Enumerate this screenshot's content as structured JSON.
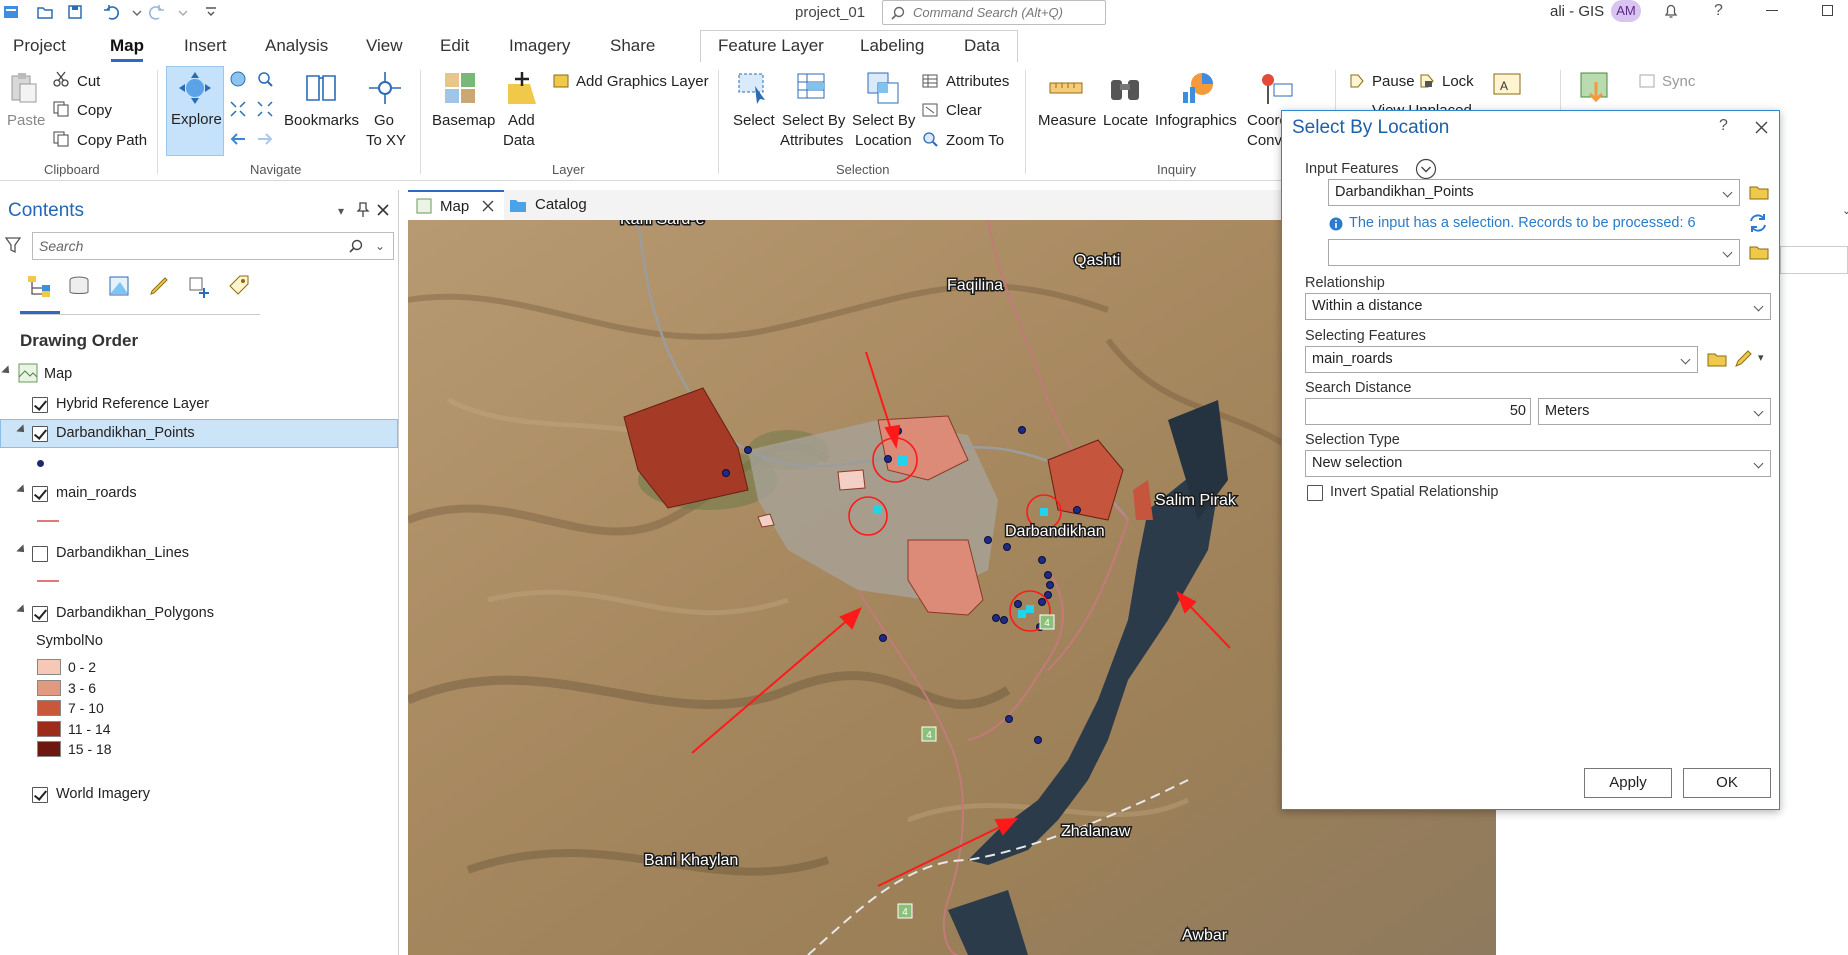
{
  "window": {
    "project_title": "project_01",
    "command_search_placeholder": "Command Search (Alt+Q)",
    "user_name": "ali - GIS",
    "avatar_initials": "AM"
  },
  "ribbon_tabs": [
    "Project",
    "Map",
    "Insert",
    "Analysis",
    "View",
    "Edit",
    "Imagery",
    "Share"
  ],
  "active_tab": "Map",
  "context_tabs": [
    "Feature Layer",
    "Labeling",
    "Data"
  ],
  "ribbon": {
    "clipboard": {
      "paste": "Paste",
      "cut": "Cut",
      "copy": "Copy",
      "copy_path": "Copy Path",
      "group": "Clipboard"
    },
    "navigate": {
      "explore": "Explore",
      "bookmarks": "Bookmarks",
      "go_to_xy_1": "Go",
      "go_to_xy_2": "To XY",
      "group": "Navigate"
    },
    "layer": {
      "basemap": "Basemap",
      "add_data_1": "Add",
      "add_data_2": "Data",
      "add_graphics": "Add Graphics Layer",
      "group": "Layer"
    },
    "selection": {
      "select": "Select",
      "select_attr_1": "Select By",
      "select_attr_2": "Attributes",
      "select_loc_1": "Select By",
      "select_loc_2": "Location",
      "attributes": "Attributes",
      "clear": "Clear",
      "zoom_to": "Zoom To",
      "group": "Selection"
    },
    "inquiry": {
      "measure": "Measure",
      "locate": "Locate",
      "infographics": "Infographics",
      "coord_1": "Coord",
      "coord_2": "Conv",
      "group": "Inquiry"
    },
    "labeling": {
      "pause": "Pause",
      "lock": "Lock",
      "view_unplaced": "View Unplaced",
      "sync": "Sync"
    }
  },
  "contents": {
    "title": "Contents",
    "search_placeholder": "Search",
    "section": "Drawing Order",
    "map_name": "Map",
    "layers": {
      "hybrid": "Hybrid Reference Layer",
      "points": "Darbandikhan_Points",
      "roads": "main_roards",
      "lines": "Darbandikhan_Lines",
      "polygons": "Darbandikhan_Polygons",
      "world": "World Imagery"
    },
    "symbol_field": "SymbolNo",
    "classes": [
      {
        "label": "0 - 2",
        "color": "#f6c8b6"
      },
      {
        "label": "3 - 6",
        "color": "#e09a80"
      },
      {
        "label": "7 - 10",
        "color": "#c9573a"
      },
      {
        "label": "11 - 14",
        "color": "#9b2d1a"
      },
      {
        "label": "15 - 18",
        "color": "#6e1710"
      }
    ]
  },
  "map_tabs": {
    "map": "Map",
    "catalog": "Catalog"
  },
  "map_labels": {
    "kani": "Kani Sard-e",
    "qashti": "Qashti",
    "faqilina": "Faqilina",
    "salim": "Salim Pirak",
    "darbandikhan": "Darbandikhan",
    "zhalanaw": "Zhalanaw",
    "bani": "Bani Khaylan",
    "awbar": "Awbar",
    "road_no": "4"
  },
  "dialog": {
    "title": "Select By Location",
    "input_features_label": "Input Features",
    "input_features_value": "Darbandikhan_Points",
    "selection_info": "The input has a selection. Records to be processed: 6",
    "relationship_label": "Relationship",
    "relationship_value": "Within a distance",
    "selecting_label": "Selecting Features",
    "selecting_value": "main_roards",
    "distance_label": "Search Distance",
    "distance_value": "50",
    "distance_unit": "Meters",
    "selection_type_label": "Selection Type",
    "selection_type_value": "New selection",
    "invert_label": "Invert Spatial Relationship",
    "apply": "Apply",
    "ok": "OK"
  },
  "colors": {
    "accent": "#2367b5",
    "selection_cyan": "#22d3ee",
    "annotation_red": "#ff1a1a"
  }
}
